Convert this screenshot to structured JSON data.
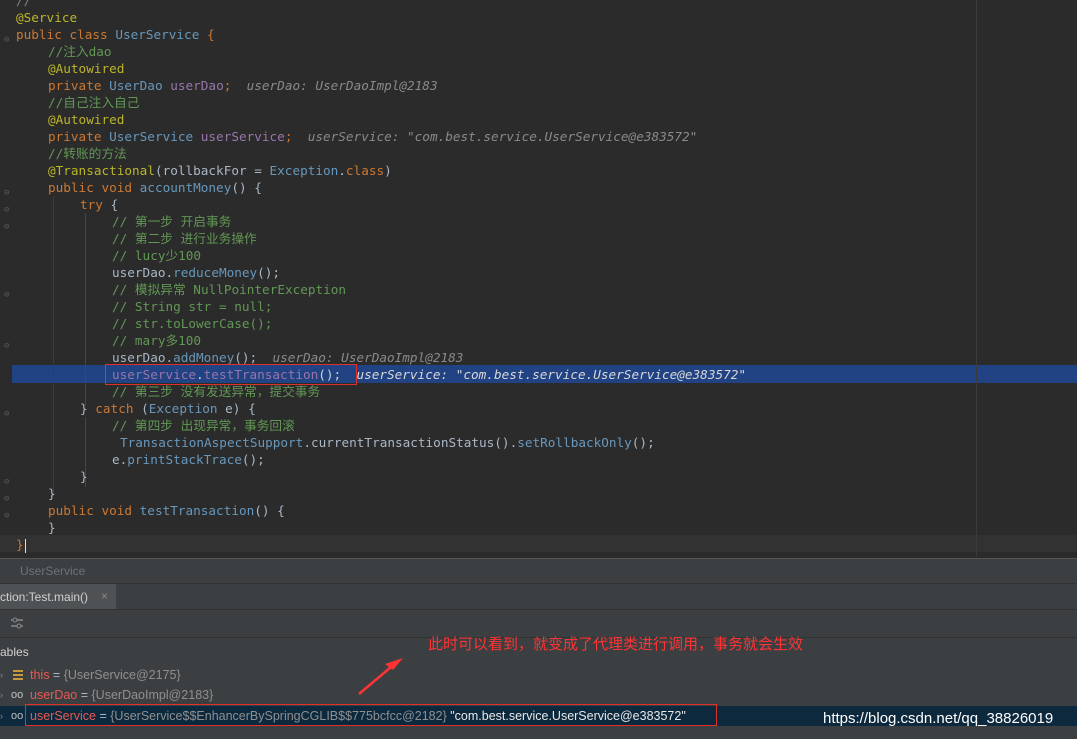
{
  "editor": {
    "lines": {
      "l0": "//",
      "l1": "@Service",
      "l2_kw": "public class ",
      "l2_name": "UserService",
      "l2_brace": " {",
      "l3": "//注入dao",
      "l4": "@Autowired",
      "l5_kw": "private ",
      "l5_type": "UserDao",
      "l5_var": " userDao",
      "l5_semi": ";",
      "l5_hint": "userDao: UserDaoImpl@2183",
      "l6": "//自己注入自己",
      "l7": "@Autowired",
      "l8_kw": "private ",
      "l8_type": "UserService",
      "l8_var": " userService",
      "l8_semi": ";",
      "l8_hint": "userService: \"com.best.service.UserService@e383572\"",
      "l9": "//转账的方法",
      "l10_an": "@Transactional",
      "l10_a": "(rollbackFor = ",
      "l10_t": "Exception",
      "l10_b": ".",
      "l10_c": "class",
      "l10_d": ")",
      "l11_kw": "public void ",
      "l11_me": "accountMoney",
      "l11_rest": "() {",
      "l12_kw": "try",
      "l12_rest": " {",
      "l13": "// 第一步 开启事务",
      "l14": "// 第二步 进行业务操作",
      "l15": "// lucy少100",
      "l16_a": "userDao",
      "l16_b": ".",
      "l16_c": "reduceMoney",
      "l16_d": "();",
      "l17": "// 模拟异常 NullPointerException",
      "l18": "// String str = null;",
      "l19": "// str.toLowerCase();",
      "l20": "// mary多100",
      "l21_a": "userDao",
      "l21_b": ".",
      "l21_c": "addMoney",
      "l21_d": "();",
      "l21_hint": "userDao: UserDaoImpl@2183",
      "l22_a": "userService",
      "l22_b": ".",
      "l22_c": "testTransaction",
      "l22_d": "();",
      "l22_hint": "userService: \"com.best.service.UserService@e383572\"",
      "l23": "// 第三步 没有发送异常，提交事务",
      "l24_a": "} ",
      "l24_kw": "catch",
      "l24_b": " (",
      "l24_t": "Exception",
      "l24_c": " e) {",
      "l25": "// 第四步 出现异常，事务回滚",
      "l26_a": "TransactionAspectSupport",
      "l26_b": ".currentTransactionStatus().",
      "l26_c": "setRollbackOnly",
      "l26_d": "();",
      "l27_a": "e",
      "l27_b": ".",
      "l27_c": "printStackTrace",
      "l27_d": "();",
      "l28": "}",
      "l29": "}",
      "l30_kw": "public void ",
      "l30_me": "testTransaction",
      "l30_rest": "() {",
      "l31": "}",
      "l32": "}"
    }
  },
  "breadcrumb": {
    "label": "UserService"
  },
  "frames": {
    "tab_label": "ction:Test.main()",
    "close": "×"
  },
  "variables": {
    "header": "ables",
    "rows": [
      {
        "name": "this",
        "eq": " = ",
        "value": "{UserService@2175}",
        "str": ""
      },
      {
        "name": "userDao",
        "eq": " = ",
        "value": "{UserDaoImpl@2183}",
        "str": ""
      },
      {
        "name": "userService",
        "eq": " = ",
        "value": "{UserService$$EnhancerBySpringCGLIB$$775bcfcc@2182}",
        "str": " \"com.best.service.UserService@e383572\""
      }
    ]
  },
  "annotation": {
    "note": "此时可以看到，就变成了代理类进行调用，事务就会生效"
  },
  "watermark": "https://blog.csdn.net/qq_38826019",
  "colors": {
    "highlight": "#214283",
    "annotation": "#ff3333",
    "keyword": "#cc7832",
    "string_hint": "#8a8a8a"
  }
}
